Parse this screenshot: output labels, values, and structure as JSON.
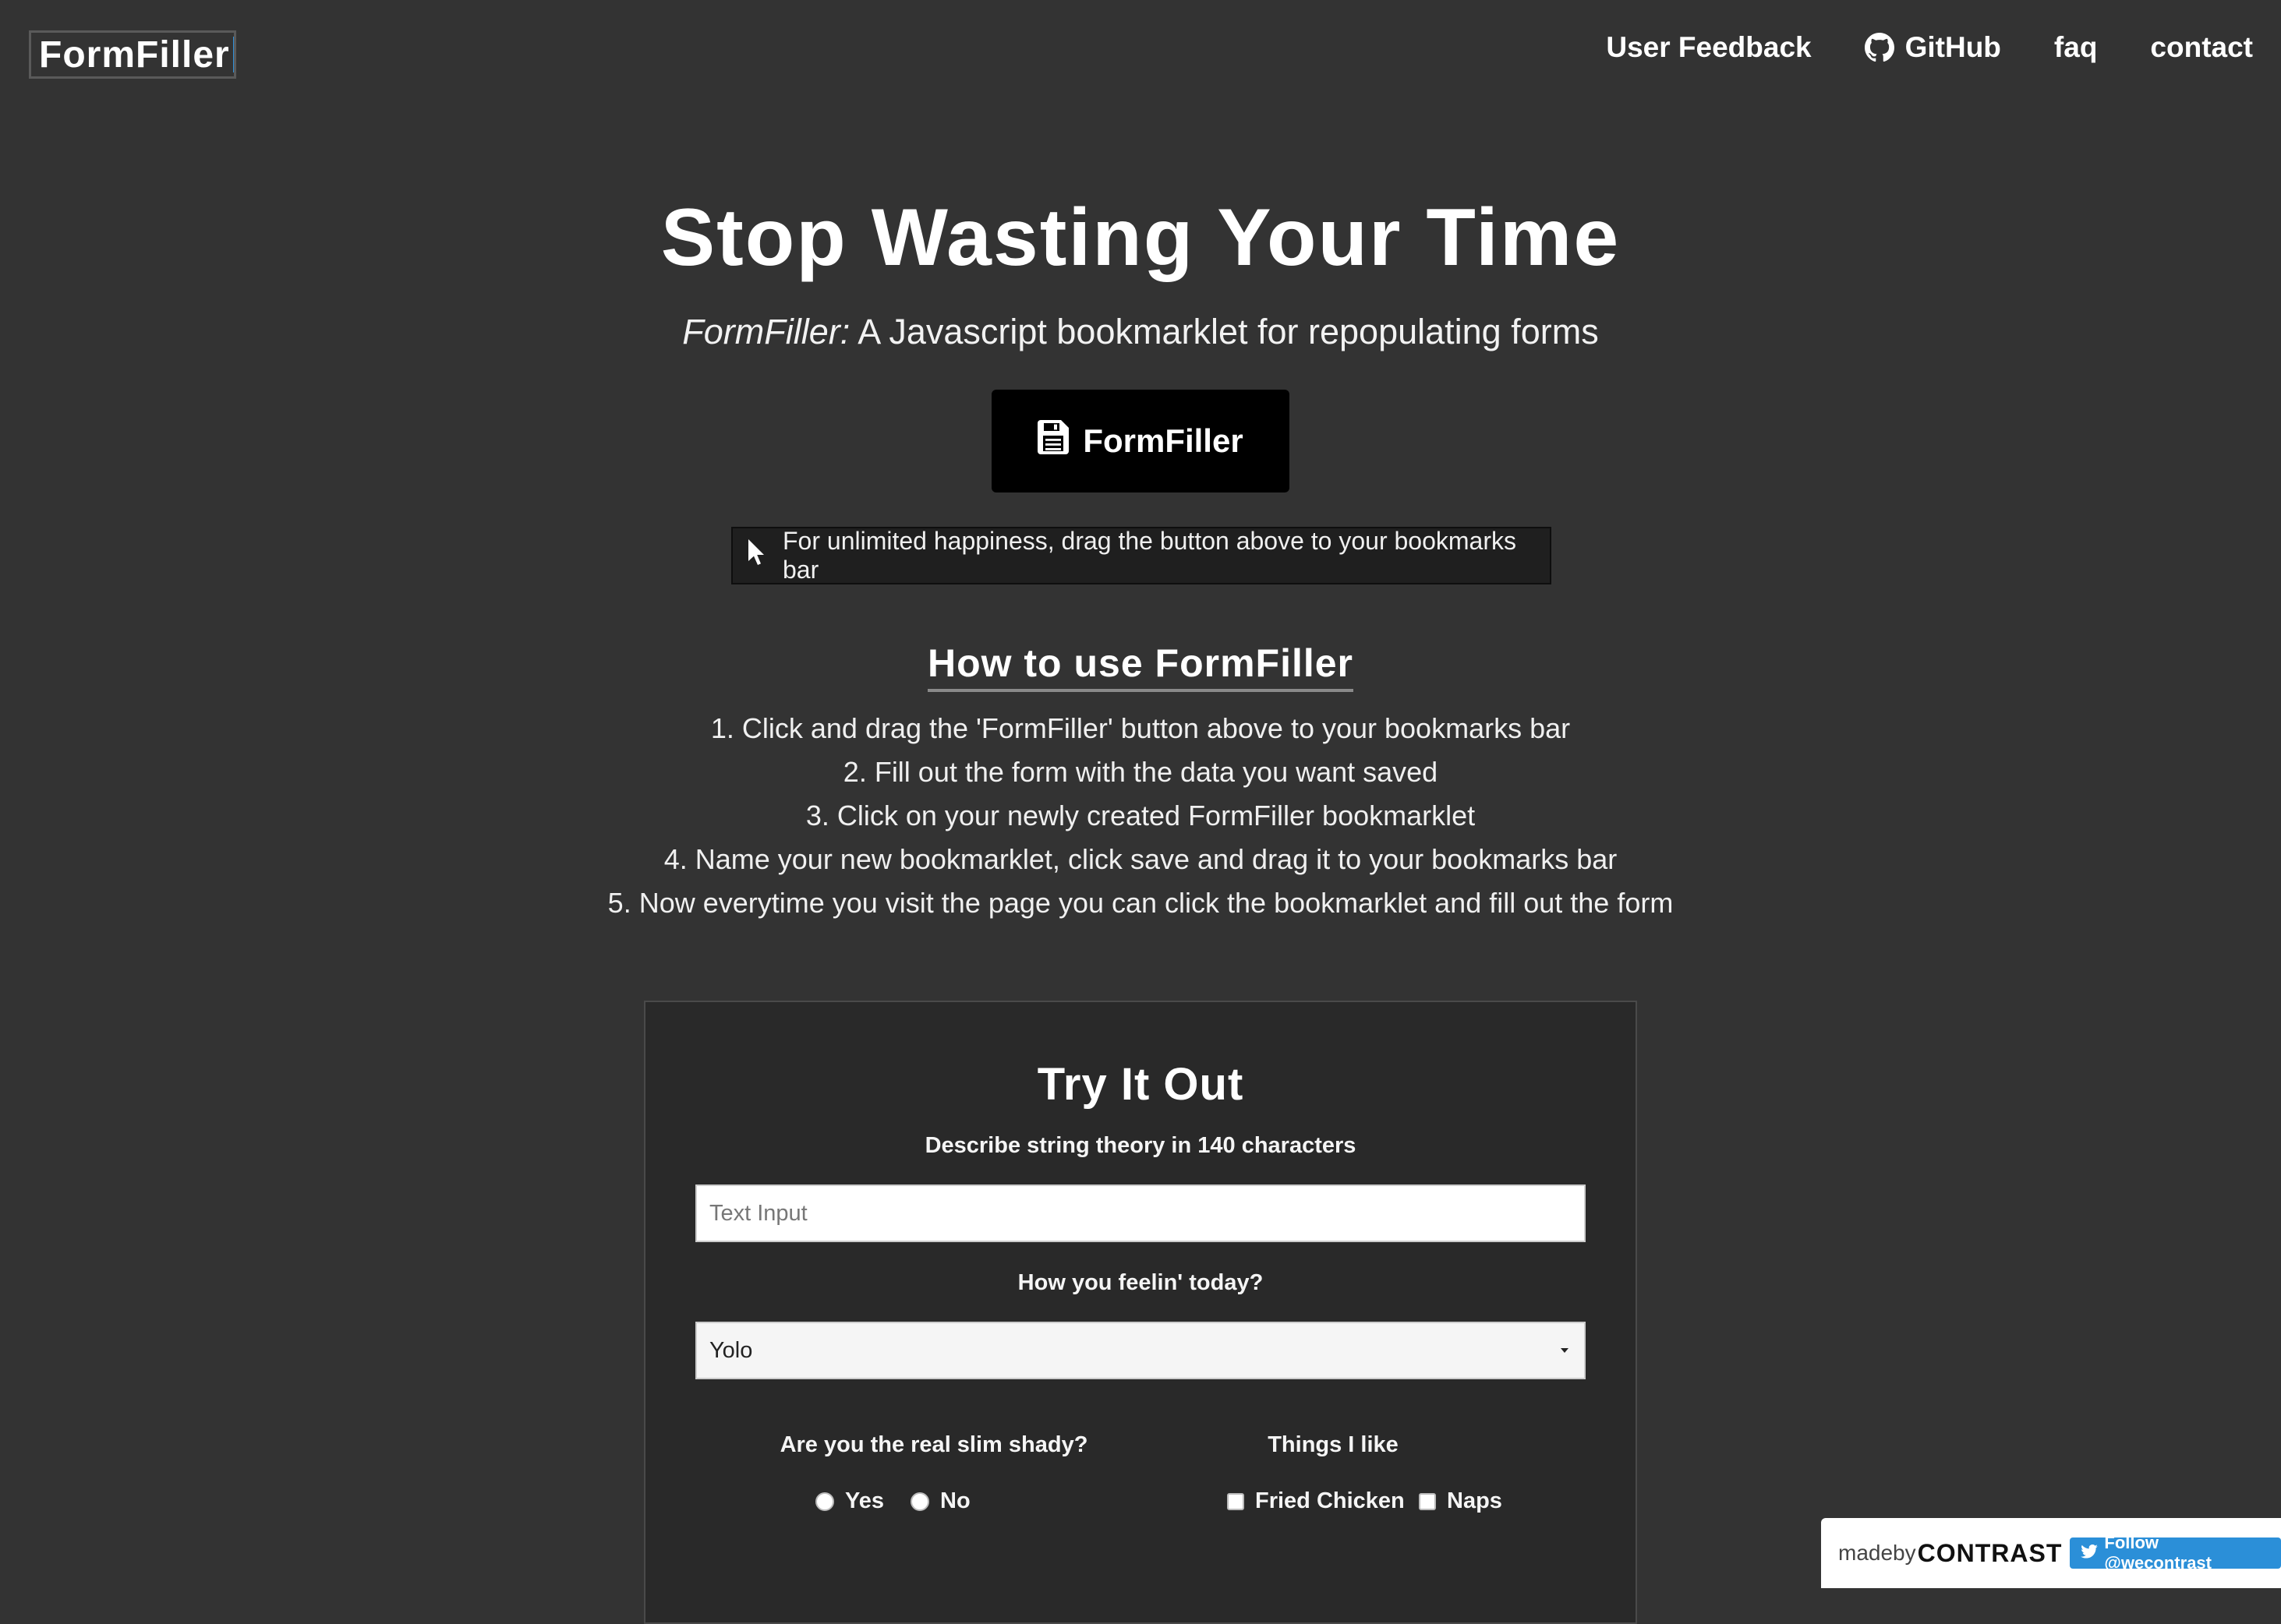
{
  "header": {
    "logo": "FormFiller",
    "nav": {
      "feedback": "User Feedback",
      "github": "GitHub",
      "faq": "faq",
      "contact": "contact"
    }
  },
  "hero": {
    "title": "Stop Wasting Your Time",
    "subtitle_em": "FormFiller:",
    "subtitle_rest": " A Javascript bookmarklet for repopulating forms",
    "button_label": "FormFiller",
    "drag_hint": "For unlimited happiness, drag the button above to your bookmarks bar"
  },
  "howto": {
    "title": "How to use FormFiller",
    "steps": [
      "1. Click and drag the 'FormFiller' button above to your bookmarks bar",
      "2. Fill out the form with the data you want saved",
      "3. Click on your newly created FormFiller bookmarklet",
      "4. Name your new bookmarklet, click save and drag it to your bookmarks bar",
      "5. Now everytime you visit the page you can click the bookmarklet and fill out the form"
    ]
  },
  "tryit": {
    "title": "Try It Out",
    "q1_label": "Describe string theory in 140 characters",
    "q1_placeholder": "Text Input",
    "q2_label": "How you feelin' today?",
    "q2_selected": "Yolo",
    "q3_label": "Are you the real slim shady?",
    "q3_options": [
      "Yes",
      "No"
    ],
    "q4_label": "Things I like",
    "q4_options": [
      "Fried Chicken",
      "Naps"
    ]
  },
  "badge": {
    "madeby": "madeby",
    "brand": "CONTRAST",
    "follow": "Follow @wecontrast"
  },
  "colors": {
    "background": "#333333",
    "panel": "#292929",
    "button": "#000000",
    "accent_blue": "#2b8fd8"
  },
  "icons": {
    "github": "github-icon",
    "save": "floppy-disk-icon",
    "pointer": "mouse-pointer-icon",
    "twitter": "twitter-bird-icon"
  }
}
